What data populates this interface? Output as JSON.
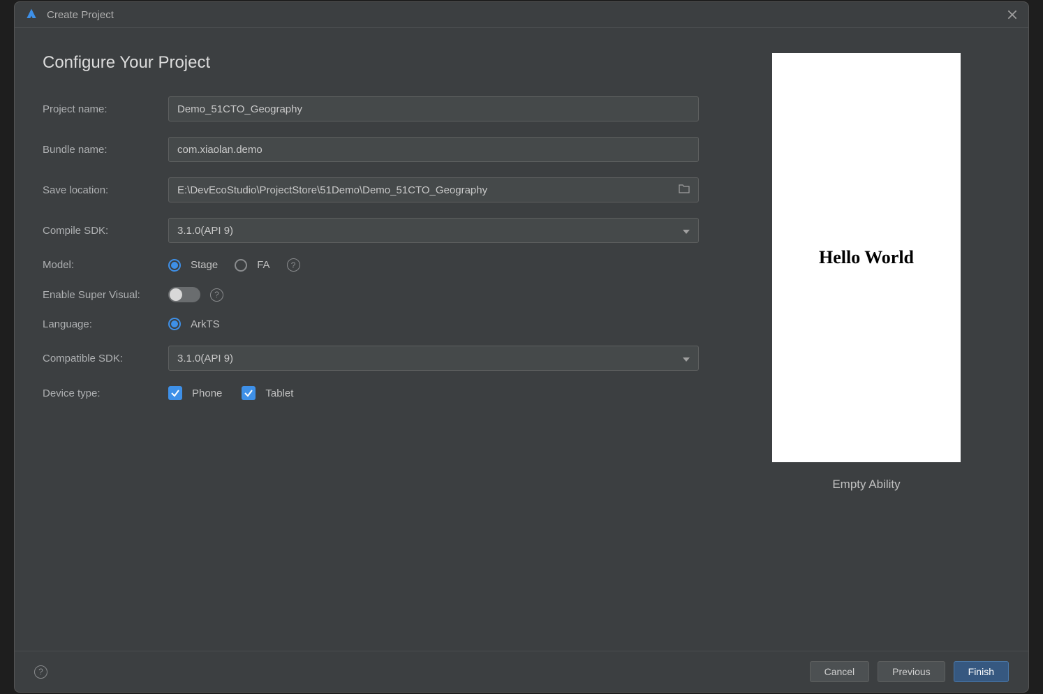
{
  "window": {
    "title": "Create Project"
  },
  "heading": "Configure Your Project",
  "form": {
    "project_name": {
      "label": "Project name:",
      "value": "Demo_51CTO_Geography"
    },
    "bundle_name": {
      "label": "Bundle name:",
      "value": "com.xiaolan.demo"
    },
    "save_location": {
      "label": "Save location:",
      "value": "E:\\DevEcoStudio\\ProjectStore\\51Demo\\Demo_51CTO_Geography"
    },
    "compile_sdk": {
      "label": "Compile SDK:",
      "value": "3.1.0(API 9)"
    },
    "model": {
      "label": "Model:",
      "options": {
        "stage": "Stage",
        "fa": "FA"
      },
      "selected": "stage"
    },
    "enable_super_visual": {
      "label": "Enable Super Visual:",
      "value": false
    },
    "language": {
      "label": "Language:",
      "options": {
        "arkts": "ArkTS"
      },
      "selected": "arkts"
    },
    "compatible_sdk": {
      "label": "Compatible SDK:",
      "value": "3.1.0(API 9)"
    },
    "device_type": {
      "label": "Device type:",
      "options": {
        "phone": "Phone",
        "tablet": "Tablet"
      },
      "checked": {
        "phone": true,
        "tablet": true
      }
    }
  },
  "preview": {
    "text": "Hello World",
    "template_name": "Empty Ability"
  },
  "footer": {
    "cancel": "Cancel",
    "previous": "Previous",
    "finish": "Finish"
  }
}
